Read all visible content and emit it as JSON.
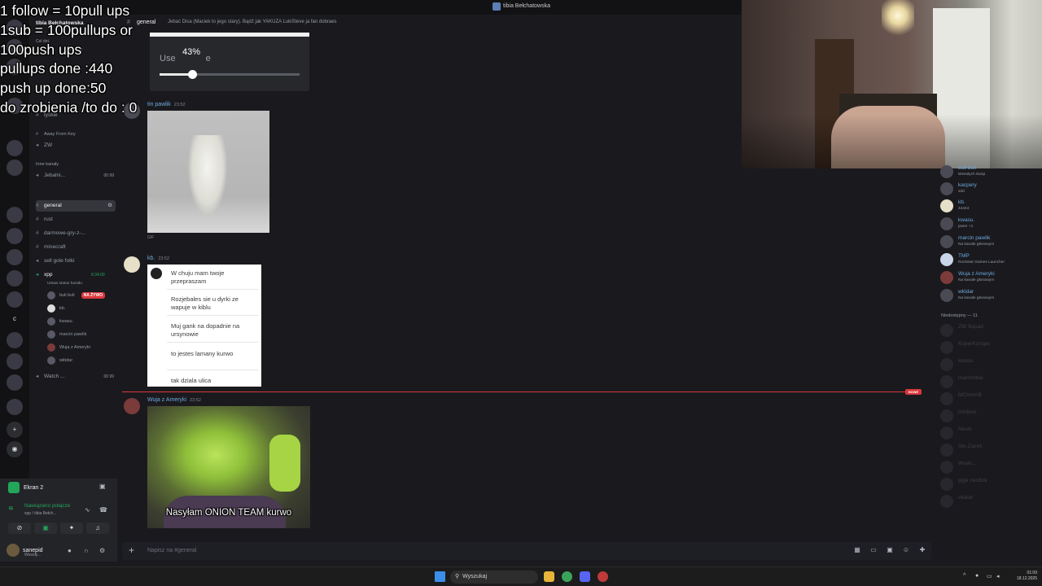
{
  "window": {
    "title": "tibia Bełchatowska"
  },
  "overlay": {
    "lines": [
      "1 follow = 10pull ups",
      "1sub = 100pullups or",
      "100push ups",
      "pullups done :440",
      "push up done:50",
      "do zrobienia /to do : 0"
    ]
  },
  "sidebar": {
    "server_name": "tibia Bełchatowska",
    "partial_labels": [
      "Cel dnt.",
      "Licznik"
    ],
    "channels": [
      {
        "name": "tyskie",
        "type": "text"
      },
      {
        "name": "Away From Key",
        "type": "voice"
      },
      {
        "name": "ZW",
        "type": "voice"
      },
      {
        "name": "Inne kanały",
        "type": "category"
      },
      {
        "name": "Jebalni...",
        "type": "voice",
        "count": "00 99"
      },
      {
        "name": "general",
        "type": "text",
        "active": true
      },
      {
        "name": "rust",
        "type": "text"
      },
      {
        "name": "darmowe-gry-z-...",
        "type": "text"
      },
      {
        "name": "minecraft",
        "type": "text"
      },
      {
        "name": "sell gole fotki",
        "type": "voice"
      },
      {
        "name": "xpp",
        "type": "voice",
        "timer": "6:34:00"
      },
      {
        "name": "Watch ...",
        "type": "voice",
        "count": "00 99"
      }
    ],
    "voice_status": "Ustaw status kanału",
    "voice_users": [
      {
        "name": "buli buli",
        "live": "NA ŻYWO"
      },
      {
        "name": "kb."
      },
      {
        "name": "kwasu."
      },
      {
        "name": "marcin pawlik"
      },
      {
        "name": "Wuja z Ameryki"
      },
      {
        "name": "włódar"
      }
    ]
  },
  "user_panel": {
    "screen_label": "Ekran 2",
    "connection_status": "Nawiązano połącze",
    "connection_sub": "xpp / tibia Bełch...",
    "username": "sanepid",
    "user_status": "Wesoły..."
  },
  "chat": {
    "channel_name": "general",
    "topic": "Jebać Disa (Maciek to jego stary). Bądź jak YAKUZA LukiSteve ja fan dobraes",
    "slider": {
      "label": "Use",
      "label_tail": "e",
      "percent_text": "43%",
      "value": 0.23
    },
    "messages": [
      {
        "author": "tin pawlik",
        "time": "23:52",
        "attachment": "GIF"
      },
      {
        "author": "kb.",
        "time": "23:52",
        "note_lines": [
          "W chuju mam twoje przepraszam",
          "Rozjebales sie u dyrki ze wapuje w kiblu",
          "Muj gank na dopadnie na ursynowie",
          "to jestes lamany kurwo",
          "tak dziala ulica"
        ]
      },
      {
        "author": "Wuja z Ameryki",
        "time": "23:52",
        "caption": "Nasyłam ONION TEAM kurwo"
      }
    ],
    "new_badge": "NOWE",
    "composer_placeholder": "Napisz na #general"
  },
  "members": {
    "online": [
      {
        "name": "buli buli",
        "status": "Wesołych świąt",
        "color": "#6fa8dc"
      },
      {
        "name": "kacpery",
        "status": "xdd",
        "color": "#6fa8dc"
      },
      {
        "name": "kb.",
        "status": "44444",
        "color": "#6fa8dc"
      },
      {
        "name": "kwasu.",
        "status": "javier +1",
        "color": "#6fa8dc"
      },
      {
        "name": "marcin pawlik",
        "status": "Na kanale głosowym",
        "color": "#6fa8dc"
      },
      {
        "name": "TMP",
        "status": "Rockstar Games Launcher",
        "color": "#6fa8dc"
      },
      {
        "name": "Wuja z Ameryki",
        "status": "Na kanale głosowym",
        "color": "#6fa8dc"
      },
      {
        "name": "włódar",
        "status": "Na kanale głosowym",
        "color": "#6fa8dc"
      }
    ],
    "offline_header": "Niedostępny — 11",
    "offline": [
      {
        "name": "ZW Squad",
        "tag": "APL"
      },
      {
        "name": "KoperKiznger"
      },
      {
        "name": "kwasu"
      },
      {
        "name": "marmoltoe"
      },
      {
        "name": "MChmmB"
      },
      {
        "name": "mloblox"
      },
      {
        "name": "Nicelt"
      },
      {
        "name": "Sto Ziarek"
      },
      {
        "name": "Woah..."
      },
      {
        "name": "gige nerdtok",
        "tag": "APL"
      },
      {
        "name": "vitalok",
        "tag": "APL"
      }
    ]
  },
  "taskbar": {
    "search_label": "Wyszukaj",
    "time": "01:09",
    "date": "18.12.2025"
  },
  "colors": {
    "accent": "#5865f2",
    "online": "#23a55a",
    "live": "#da373c",
    "link": "#6fa8dc"
  }
}
